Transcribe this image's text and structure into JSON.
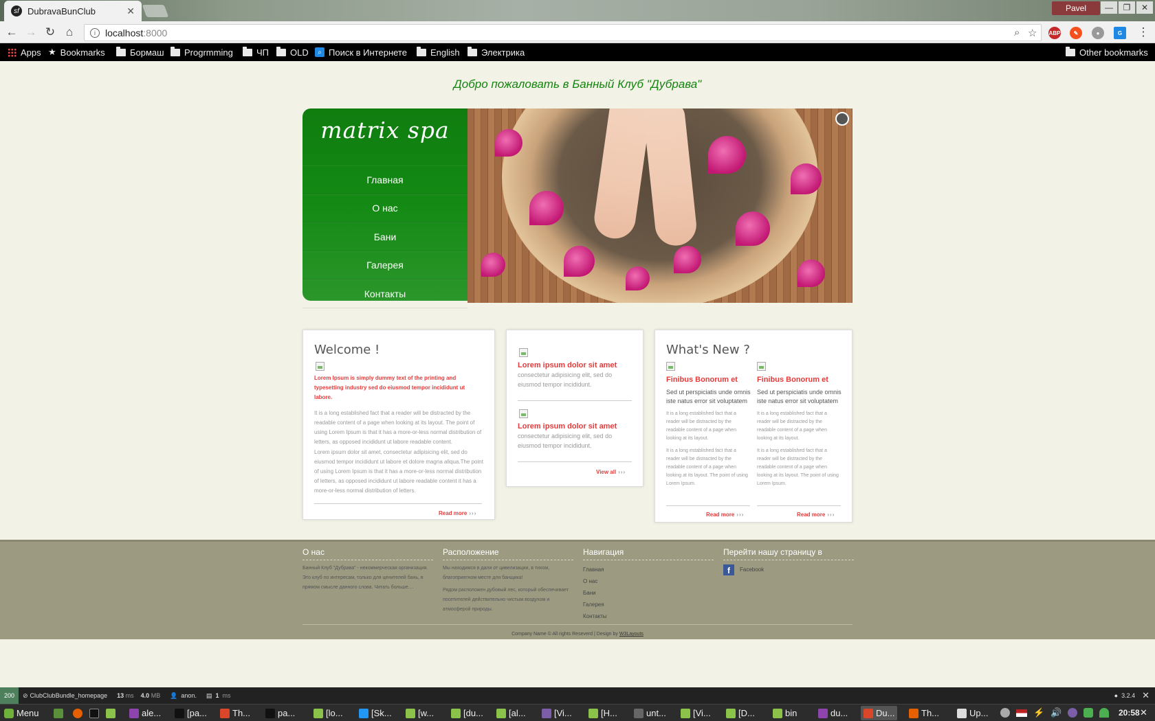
{
  "browser": {
    "tab_title": "DubravaBunClub",
    "tab_favicon": "sf",
    "profile_name": "Pavel",
    "url_host": "localhost",
    "url_port": ":8000",
    "ext_abp": "ABP",
    "bookmarks": [
      "Apps",
      "Bookmarks",
      "Бормаш",
      "Progrmming",
      "ЧП",
      "OLD",
      "Поиск в Интернете",
      "English",
      "Электрика"
    ],
    "other_bookmarks": "Other bookmarks"
  },
  "site": {
    "welcome": "Добро пожаловать в Банный Клуб \"Дубрава\"",
    "logo": "matrix spa",
    "menu": [
      "Главная",
      "О нас",
      "Бани",
      "Галерея",
      "Контакты"
    ],
    "welcome_card": {
      "title": "Welcome !",
      "lead": "Lorem Ipsum is simply dummy text of the printing and typesetting industry sed do eiusmod tempor incididunt ut labore.",
      "p1": "It is a long established fact that a reader will be distracted by the readable content of a page when looking at its layout. The point of using Lorem Ipsum is that it has a more-or-less normal distribution of letters, as opposed incididunt ut labore readable content.",
      "p2": "Lorem ipsum dolor sit amet, consectetur adipisicing elit, sed do eiusmod tempor incididunt ut labore et dolore magna aliqua.The point of using Lorem Ipsum is that it has a more-or-less normal distribution of letters, as opposed incididunt ut labore readable content it has a more-or-less normal distribution of letters.",
      "more": "Read more",
      "arrows": "›››"
    },
    "news_card": {
      "items": [
        {
          "title": "Lorem ipsum dolor sit amet",
          "text": "consectetur adipisicing elit, sed do eiusmod tempor incididunt."
        },
        {
          "title": "Lorem ipsum dolor sit amet",
          "text": "consectetur adipisicing elit, sed do eiusmod tempor incididunt."
        }
      ],
      "view_all": "View all",
      "arrows": "›››"
    },
    "whats_new": {
      "title": "What's New ?",
      "cols": [
        {
          "title": "Finibus Bonorum et",
          "sub": "Sed ut perspiciatis unde omnis iste natus error sit voluptatem",
          "p1": "It is a long established fact that a reader will be distracted by the readable content of a page when looking at its layout.",
          "p2": "It is a long established fact that a reader will be distracted by the readable content of a page when looking at its layout. The point of using Lorem Ipsum.",
          "more": "Read more"
        },
        {
          "title": "Finibus Bonorum et",
          "sub": "Sed ut perspiciatis unde omnis iste natus error sit voluptatem",
          "p1": "It is a long established fact that a reader will be distracted by the readable content of a page when looking at its layout.",
          "p2": "It is a long established fact that a reader will be distracted by the readable content of a page when looking at its layout. The point of using Lorem Ipsum.",
          "more": "Read more"
        }
      ],
      "arrows": "›››"
    },
    "footer": {
      "about_title": "О нас",
      "about_text": "Банный Клуб \"Дубрава\" - некоммерческая организация. Это клуб по интересам, только для ценителей бань, в прямом смысле данного слова. Читать больше....",
      "location_title": "Расположение",
      "location_p1": "Мы находимся в дали от цивелизации, в тихом, благоприятном месте для банщика!",
      "location_p2": "Рядом расположен дубовый лес, который обеспечивает посетителей действительно чистым воздухом и атмосферой природы.",
      "nav_title": "Навигация",
      "nav": [
        "Главная",
        "О нас",
        "Бани",
        "Галерея",
        "Контакты"
      ],
      "social_title": "Перейти нашу страницу в",
      "facebook": "Facebook",
      "copyright": "Company Name © All rights Reseverd | Design by",
      "designer": "W3Layouts"
    }
  },
  "sf_toolbar": {
    "status": "200",
    "route": "ClubClubBundle_homepage",
    "time": "13",
    "time_unit": "ms",
    "memory": "4.0",
    "memory_unit": "MB",
    "user": "anon.",
    "db": "1",
    "db_unit": "ms",
    "version": "3.2.4"
  },
  "taskbar": {
    "menu": "Menu",
    "tasks": [
      "ale...",
      "[pa...",
      "Th...",
      "pa...",
      "[lo...",
      "[Sk...",
      "[w...",
      "[du...",
      "[al...",
      "[Vi...",
      "[H...",
      "unt...",
      "[Vi...",
      "[D...",
      "bin",
      "du...",
      "Du...",
      "Th...",
      "Up..."
    ],
    "clock": "20:58"
  }
}
